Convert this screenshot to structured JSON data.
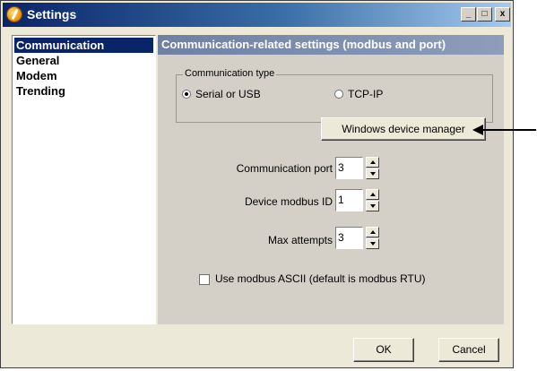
{
  "window": {
    "title": "Settings"
  },
  "titlebar_buttons": {
    "minimize": "_",
    "maximize": "□",
    "close": "x"
  },
  "sidebar": {
    "items": [
      {
        "label": "Communication",
        "selected": true
      },
      {
        "label": "General"
      },
      {
        "label": "Modem"
      },
      {
        "label": "Trending"
      }
    ]
  },
  "panel": {
    "header": "Communication-related settings (modbus and port)",
    "comm_type": {
      "title": "Communication type",
      "options": [
        {
          "label": "Serial or USB",
          "selected": true
        },
        {
          "label": "TCP-IP",
          "selected": false
        }
      ]
    },
    "device_manager_button": "Windows device manager",
    "fields": {
      "comm_port": {
        "label": "Communication port",
        "value": "3"
      },
      "modbus_id": {
        "label": "Device modbus ID",
        "value": "1"
      },
      "max_attempts": {
        "label": "Max attempts",
        "value": "3"
      }
    },
    "ascii_checkbox": {
      "label": "Use modbus ASCII (default is modbus RTU)",
      "checked": false
    }
  },
  "footer": {
    "ok": "OK",
    "cancel": "Cancel"
  }
}
